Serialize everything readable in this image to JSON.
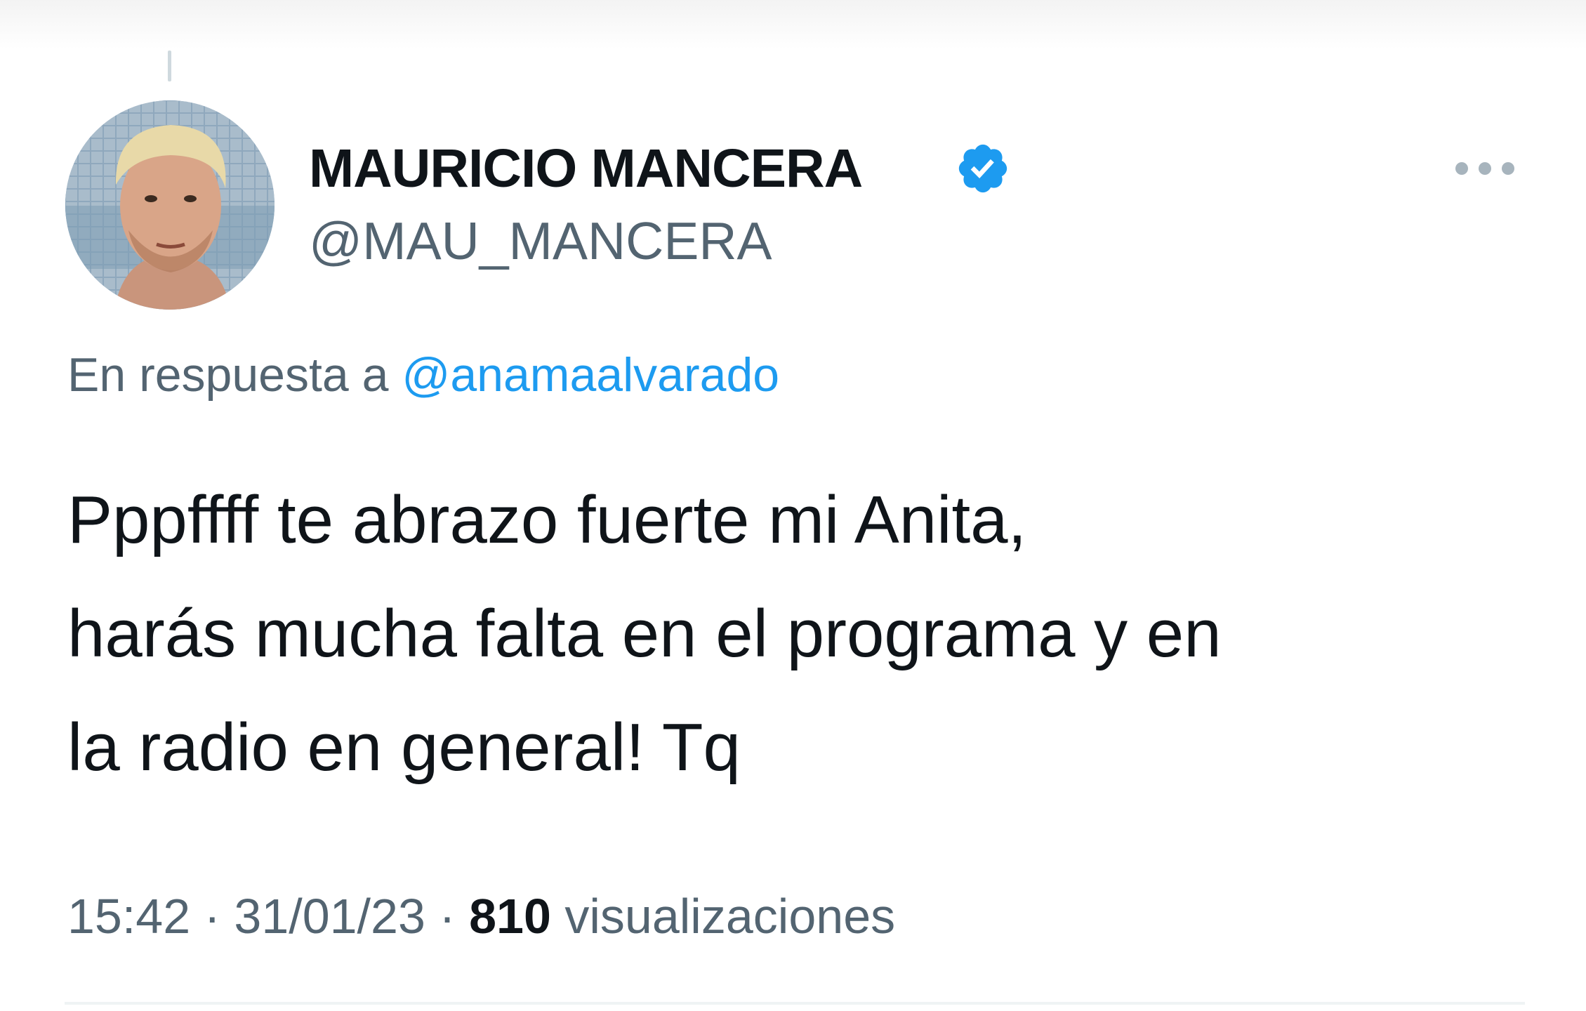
{
  "tweet": {
    "display_name": "MAURICIO MANCERA",
    "handle": "@MAU_MANCERA",
    "verified_icon": "verified-badge-icon",
    "more_icon": "more-options-icon",
    "reply_prefix": "En respuesta a ",
    "reply_to": "@anamaalvarado",
    "text_lines": [
      "Pppffff te abrazo fuerte mi Anita,",
      "harás mucha falta en el programa y en",
      "la radio en general! Tq"
    ],
    "time": "15:42",
    "separator": " · ",
    "date": "31/01/23",
    "views_count": "810",
    "views_label": " visualizaciones"
  },
  "colors": {
    "text_primary": "#0f1419",
    "text_secondary": "#536471",
    "link": "#1d9bf0",
    "verified": "#1d9bf0"
  }
}
